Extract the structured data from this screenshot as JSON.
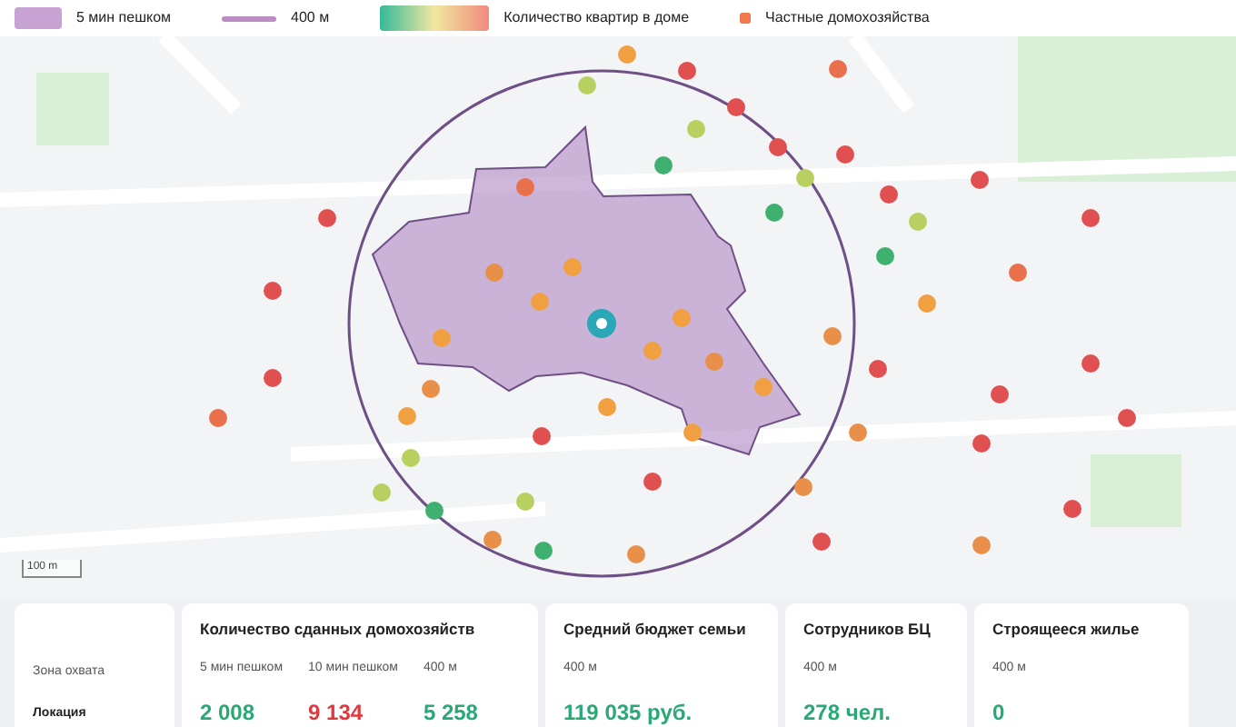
{
  "legend": [
    {
      "kind": "area",
      "label": "5 мин пешком"
    },
    {
      "kind": "line",
      "label": "400 м"
    },
    {
      "kind": "gradient",
      "label": "Количество квартир в доме"
    },
    {
      "kind": "dot",
      "label": "Частные домохозяйства"
    }
  ],
  "map": {
    "scale": "100 m"
  },
  "stats": {
    "row_labels": [
      "Зона охвата",
      "Локация"
    ],
    "groups": [
      {
        "title": "Количество сданных домохозяйств",
        "columns": [
          {
            "zone": "5 мин пешком",
            "value": "2 008",
            "color": "#2aa876"
          },
          {
            "zone": "10 мин пешком",
            "value": "9 134",
            "color": "#e0383e"
          },
          {
            "zone": "400 м",
            "value": "5 258",
            "color": "#2aa876"
          }
        ]
      },
      {
        "title": "Средний бюджет семьи",
        "columns": [
          {
            "zone": "400 м",
            "value": "119 035 руб.",
            "color": "#2aa876"
          }
        ]
      },
      {
        "title": "Сотрудников БЦ",
        "columns": [
          {
            "zone": "400 м",
            "value": "278 чел.",
            "color": "#2aa876"
          }
        ]
      },
      {
        "title": "Строящееся жилье",
        "columns": [
          {
            "zone": "400 м",
            "value": "0",
            "color": "#2aa876"
          }
        ]
      }
    ]
  }
}
